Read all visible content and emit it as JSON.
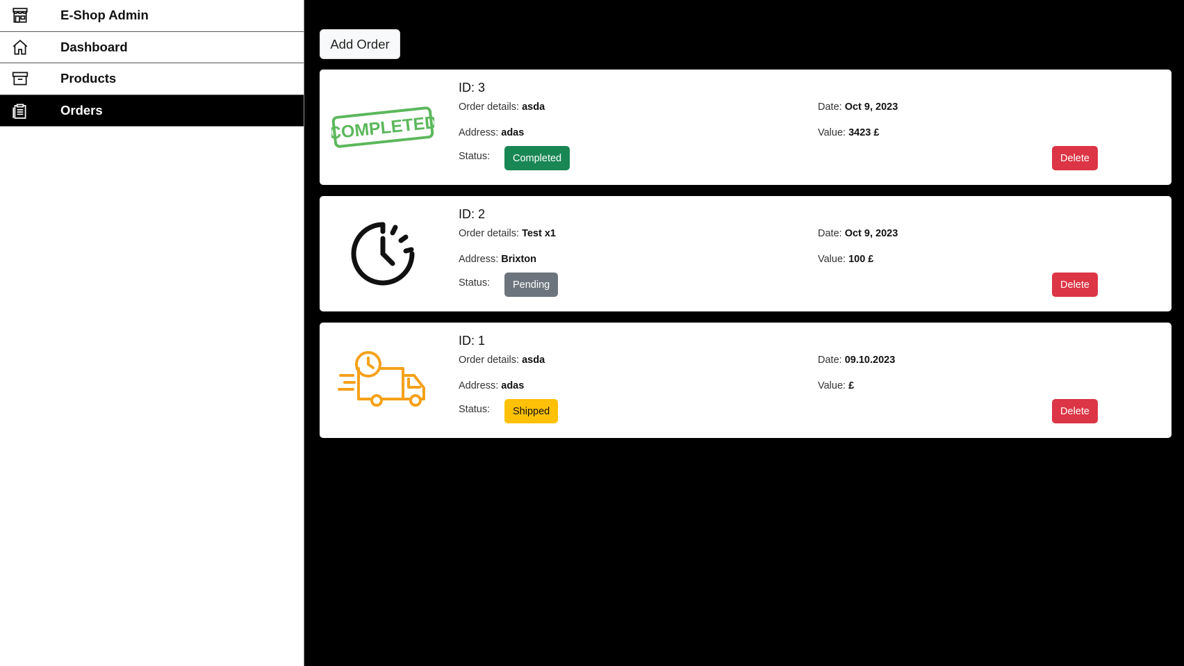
{
  "sidebar": {
    "items": [
      {
        "label": "E-Shop Admin",
        "icon": "shop-icon"
      },
      {
        "label": "Dashboard",
        "icon": "home-icon"
      },
      {
        "label": "Products",
        "icon": "archive-box-icon"
      },
      {
        "label": "Orders",
        "icon": "clipboard-list-icon",
        "active": true
      }
    ]
  },
  "main": {
    "add_label": "Add Order",
    "labels": {
      "details": "Order details:",
      "address": "Address:",
      "status": "Status:",
      "date": "Date:",
      "value": "Value:",
      "delete": "Delete"
    },
    "orders": [
      {
        "id": "ID: 3",
        "details": "asda",
        "address": "adas",
        "date": "Oct 9, 2023",
        "value": "3423 £",
        "status": "Completed",
        "image": "completed-stamp-icon",
        "stamp_text": "COMPLETED"
      },
      {
        "id": "ID: 2",
        "details": "Test x1",
        "address": "Brixton",
        "date": "Oct 9, 2023",
        "value": "100 £",
        "status": "Pending",
        "image": "clock-timer-icon"
      },
      {
        "id": "ID: 1",
        "details": "asda",
        "address": "adas",
        "date": "09.10.2023",
        "value": "£",
        "status": "Shipped",
        "image": "delivery-truck-icon"
      }
    ]
  },
  "colors": {
    "completed": "#198754",
    "pending": "#6c757d",
    "shipped": "#ffc107",
    "delete": "#dc3545",
    "stamp_green": "#5cb85c",
    "truck_orange": "#f5a11a"
  }
}
